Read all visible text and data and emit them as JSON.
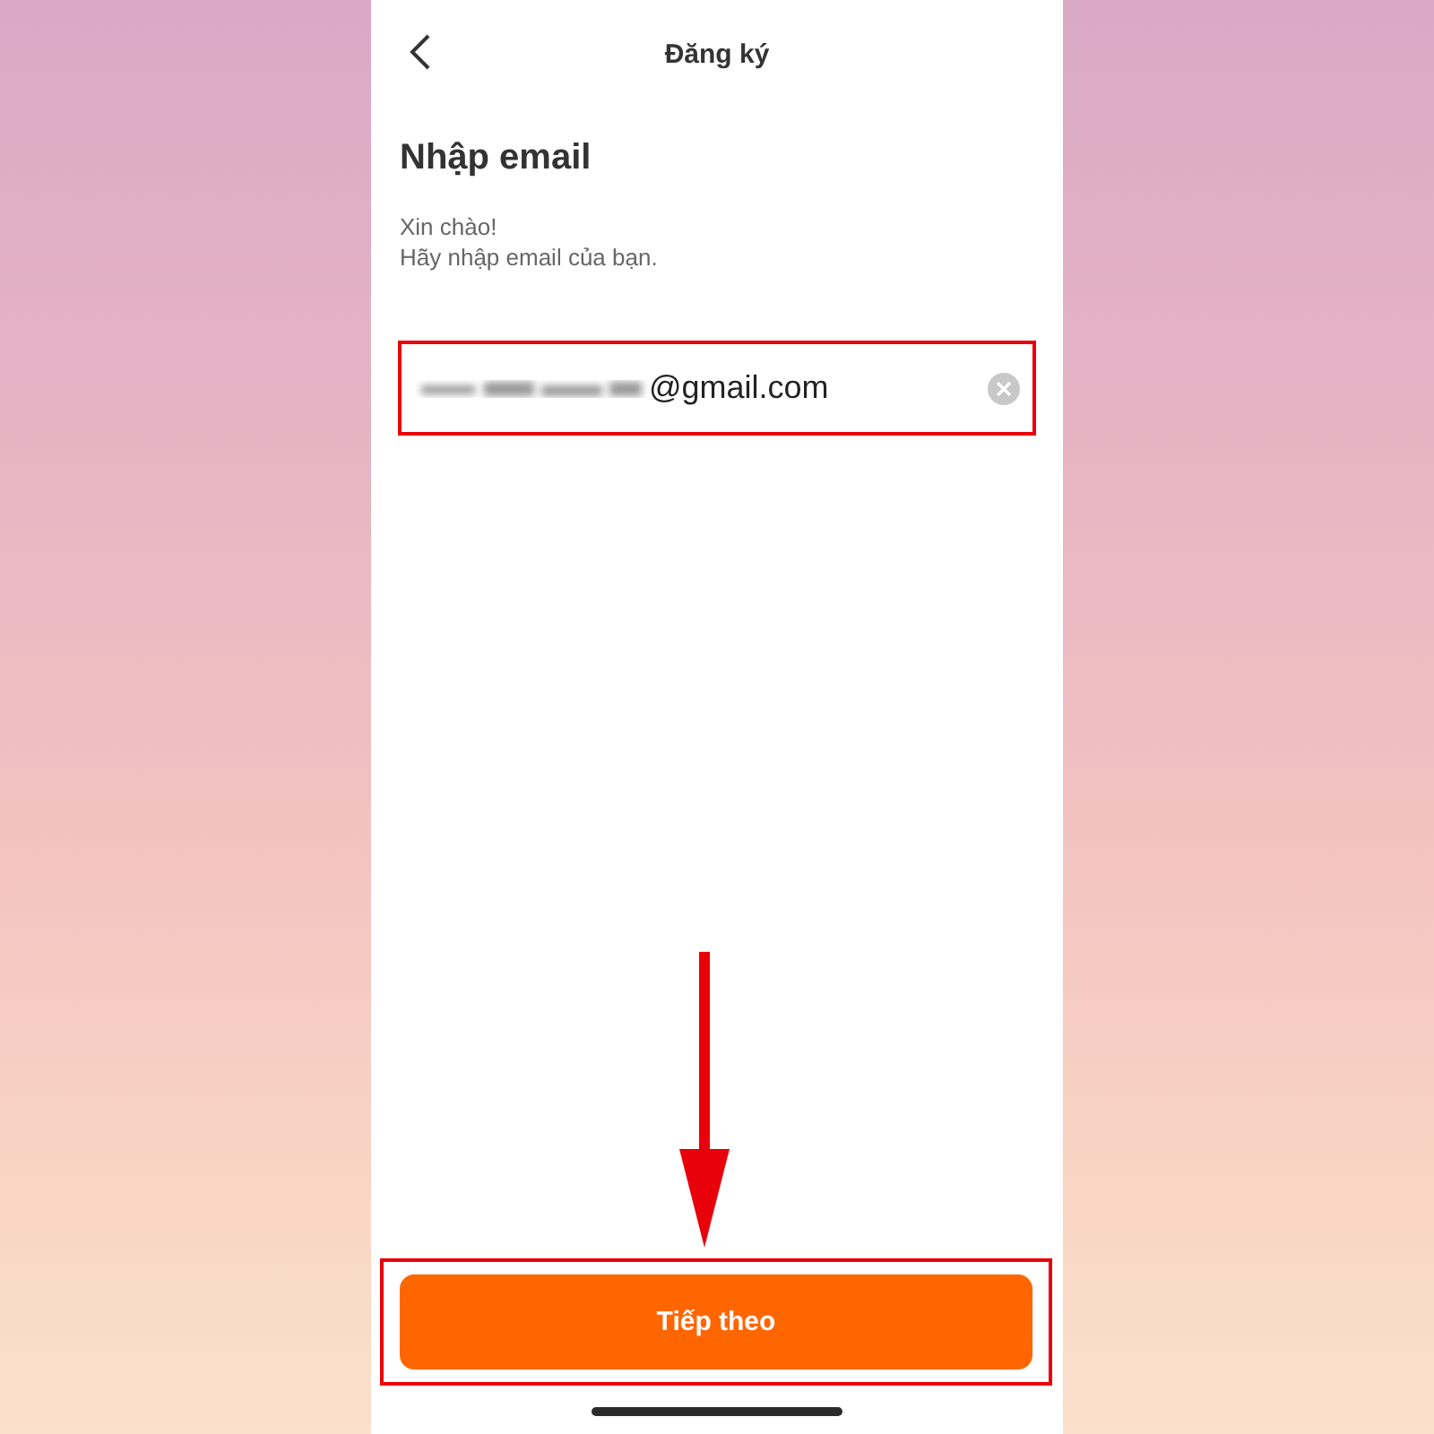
{
  "header": {
    "title": "Đăng ký"
  },
  "heading": "Nhập email",
  "greeting": [
    "Xin chào!",
    "Hãy nhập email của bạn."
  ],
  "email_field": {
    "value": "@gmail.com",
    "redacted_prefix": true,
    "highlighted": true
  },
  "next_button": {
    "label": "Tiếp theo",
    "highlighted": true,
    "pointer_arrow": true
  }
}
